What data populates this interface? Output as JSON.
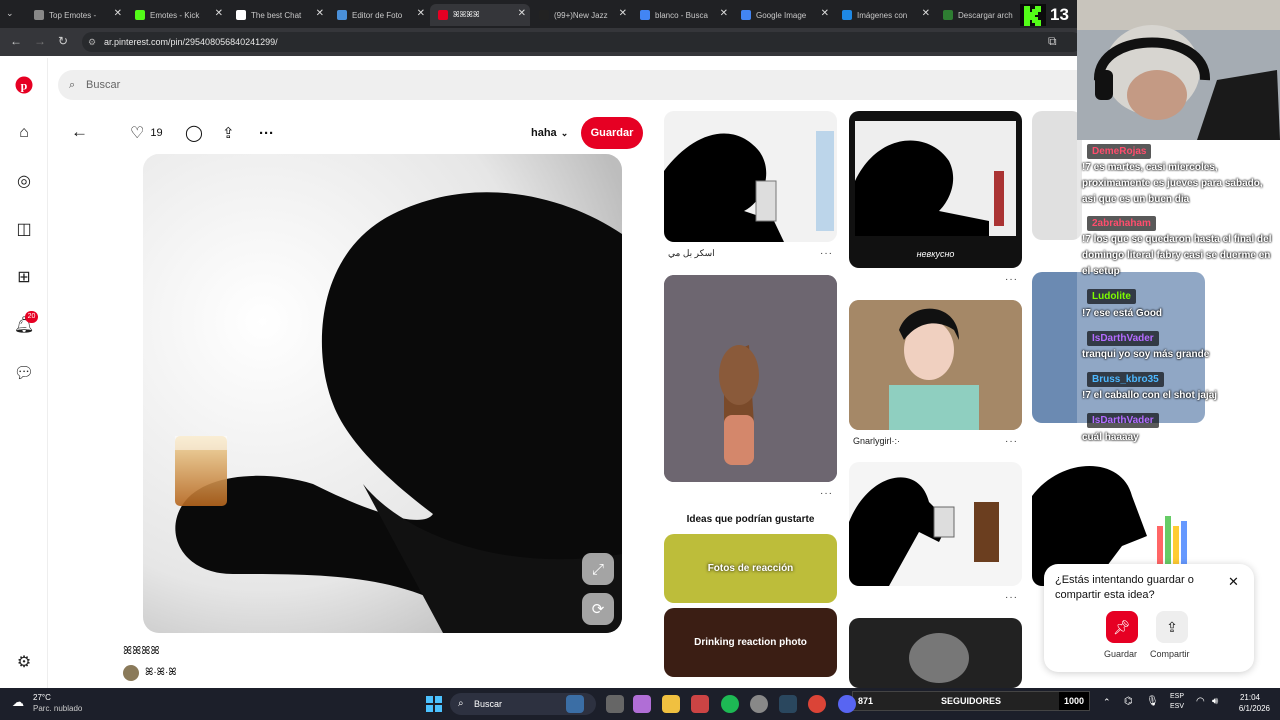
{
  "browser": {
    "tabs": [
      {
        "label": "Top Emotes - ",
        "color": "#888"
      },
      {
        "label": "Emotes - Kick",
        "color": "#53fc18"
      },
      {
        "label": "The best Chat",
        "color": "#fff"
      },
      {
        "label": "Editor de Foto",
        "color": "#4a90d9"
      },
      {
        "label": "ꕤꕤꕤꕤ",
        "color": "#e60023"
      },
      {
        "label": "(99+)New Jazz",
        "color": "#222"
      },
      {
        "label": "blanco - Busca",
        "color": "#4285f4"
      },
      {
        "label": "Google Image",
        "color": "#4285f4"
      },
      {
        "label": "Imágenes con",
        "color": "#1e88e5"
      },
      {
        "label": "Descargar arch",
        "color": "#2e7d32"
      }
    ],
    "url": "ar.pinterest.com/pin/295408056840241299/"
  },
  "pinterest": {
    "search_placeholder": "Buscar",
    "notification_count": "20",
    "like_count": "19",
    "board": "haha",
    "save_label": "Guardar",
    "pin_title": "ꕤꕤꕤꕤ",
    "author": "ꕤ·ꕤ·ꕤ",
    "grid_captions": {
      "c1": "اسكر بل مي",
      "c2": "невкусно",
      "c3": "Gnarlygirl·:·"
    },
    "ideas_title": "Ideas que podrían gustarte",
    "ideas": [
      "Fotos de reacción",
      "Drinking reaction photo"
    ],
    "popup": {
      "question": "¿Estás intentando guardar o compartir esta idea?",
      "save": "Guardar",
      "share": "Compartir"
    }
  },
  "stream": {
    "kick_count": "13",
    "chat": [
      {
        "user": "DemeRojas",
        "color": "#ff4d6d",
        "msg": "!7 es martes, casi miercoles, proximamente es jueves para sabado, asi que es un buen dia"
      },
      {
        "user": "2abrahaham",
        "color": "#ff4d6d",
        "msg": "!7 los que se quedaron hasta el final del domingo literal fabry casi se duerme en el setup"
      },
      {
        "user": "Ludolite",
        "color": "#7cfc00",
        "msg": "!7 ese está Good"
      },
      {
        "user": "IsDarthVader",
        "color": "#b36bff",
        "msg": "tranqui yo soy más grande"
      },
      {
        "user": "Bruss_kbro35",
        "color": "#4db8ff",
        "msg": "!7 el caballo con el shot jajaj"
      },
      {
        "user": "IsDarthVader",
        "color": "#b36bff",
        "msg": "cuál haaaay"
      }
    ],
    "followers_current": "871",
    "followers_label": "SEGUIDORES",
    "followers_goal": "1000",
    "followers_fraction": 0.871
  },
  "taskbar": {
    "weather_temp": "27°C",
    "weather_desc": "Parc. nublado",
    "search": "Buscar",
    "lang": "ESP",
    "lang2": "ESV",
    "time": "21:04",
    "date": "6/1/2026"
  }
}
